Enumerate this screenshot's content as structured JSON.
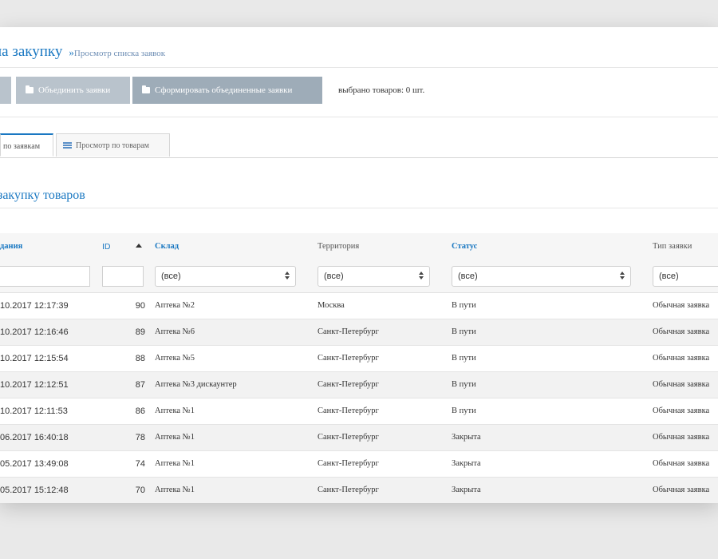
{
  "header": {
    "title": "на закупку",
    "breadcrumb_arrow": "»",
    "breadcrumb": "Просмотр списка заявок"
  },
  "toolbar": {
    "merge_label": "Объединить заявки",
    "form_label": "Сформировать объединенные заявки",
    "selected_info": "выбрано товаров: 0 шт."
  },
  "tabs": [
    {
      "label": "по заявкам",
      "active": true
    },
    {
      "label": "Просмотр по товарам",
      "active": false
    }
  ],
  "section_heading": "закупку товаров",
  "table": {
    "columns": {
      "date": "дания",
      "id": "ID",
      "warehouse": "Склад",
      "territory": "Территория",
      "status": "Статус",
      "type": "Тип заявки"
    },
    "filters": {
      "warehouse": "(все)",
      "territory": "(все)",
      "status": "(все)",
      "type": "(все)"
    },
    "rows": [
      {
        "date": "10.2017 12:17:39",
        "id": "90",
        "warehouse": "Аптека №2",
        "territory": "Москва",
        "status": "В пути",
        "type": "Обычная заявка"
      },
      {
        "date": "10.2017 12:16:46",
        "id": "89",
        "warehouse": "Аптека №6",
        "territory": "Санкт-Петербург",
        "status": "В пути",
        "type": "Обычная заявка"
      },
      {
        "date": "10.2017 12:15:54",
        "id": "88",
        "warehouse": "Аптека №5",
        "territory": "Санкт-Петербург",
        "status": "В пути",
        "type": "Обычная заявка"
      },
      {
        "date": "10.2017 12:12:51",
        "id": "87",
        "warehouse": "Аптека №3 дискаунтер",
        "territory": "Санкт-Петербург",
        "status": "В пути",
        "type": "Обычная заявка"
      },
      {
        "date": "10.2017 12:11:53",
        "id": "86",
        "warehouse": "Аптека №1",
        "territory": "Санкт-Петербург",
        "status": "В пути",
        "type": "Обычная заявка"
      },
      {
        "date": "06.2017 16:40:18",
        "id": "78",
        "warehouse": "Аптека №1",
        "territory": "Санкт-Петербург",
        "status": "Закрыта",
        "type": "Обычная заявка"
      },
      {
        "date": "05.2017 13:49:08",
        "id": "74",
        "warehouse": "Аптека №1",
        "territory": "Санкт-Петербург",
        "status": "Закрыта",
        "type": "Обычная заявка"
      },
      {
        "date": "05.2017 15:12:48",
        "id": "70",
        "warehouse": "Аптека №1",
        "territory": "Санкт-Петербург",
        "status": "Закрыта",
        "type": "Обычная заявка"
      }
    ]
  },
  "colors": {
    "accent": "#1a78c2",
    "button": "#b9c3cc",
    "button_dark": "#9eacb8"
  }
}
